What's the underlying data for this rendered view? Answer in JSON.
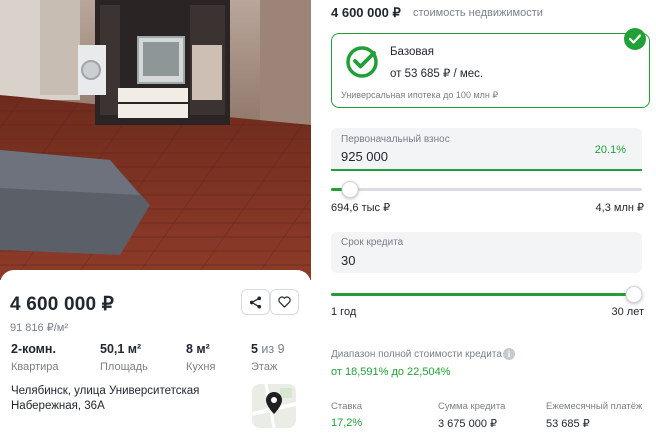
{
  "listing": {
    "price": "4 600 000 ₽",
    "price_per_m2": "91 816 ₽/м²",
    "features": [
      {
        "value": "2-комн.",
        "label": "Квартира"
      },
      {
        "value": "50,1 м²",
        "label": "Площадь"
      },
      {
        "value": "8 м²",
        "label": "Кухня"
      },
      {
        "value": "5",
        "value_suffix": " из 9",
        "label": "Этаж"
      }
    ],
    "address": "Челябинск, улица Университетская Набережная, 36А",
    "icons": {
      "share": "share-icon",
      "favorite": "heart-icon",
      "map": "map-pin-icon"
    }
  },
  "calculator": {
    "property_price": "4 600 000 ₽",
    "property_price_label": "стоимость недвижимости",
    "program": {
      "name": "Базовая",
      "payment": "от 53 685 ₽ / мес.",
      "description": "Универсальная ипотека до 100 млн ₽",
      "selected": true
    },
    "down_payment": {
      "label": "Первоначальный взнос",
      "value": "925 000",
      "percent": "20.1%",
      "slider_fraction": 0.06,
      "min": "694,6 тыс ₽",
      "max": "4,3 млн ₽"
    },
    "term": {
      "label": "Срок кредита",
      "value": "30",
      "slider_fraction": 1.0,
      "min": "1 год",
      "max": "30 лет"
    },
    "range": {
      "label": "Диапазон полной стоимости кредита",
      "value": "от 18,591% до 22,504%"
    },
    "summary": [
      {
        "label": "Ставка",
        "value": "17,2%"
      },
      {
        "label": "Сумма кредита",
        "value": "3 675 000 ₽"
      },
      {
        "label": "Ежемесячный платёж",
        "value": "53 685 ₽"
      }
    ],
    "colors": {
      "accent": "#21a038",
      "muted": "#7a8089",
      "field_bg": "#f2f4f6"
    }
  }
}
